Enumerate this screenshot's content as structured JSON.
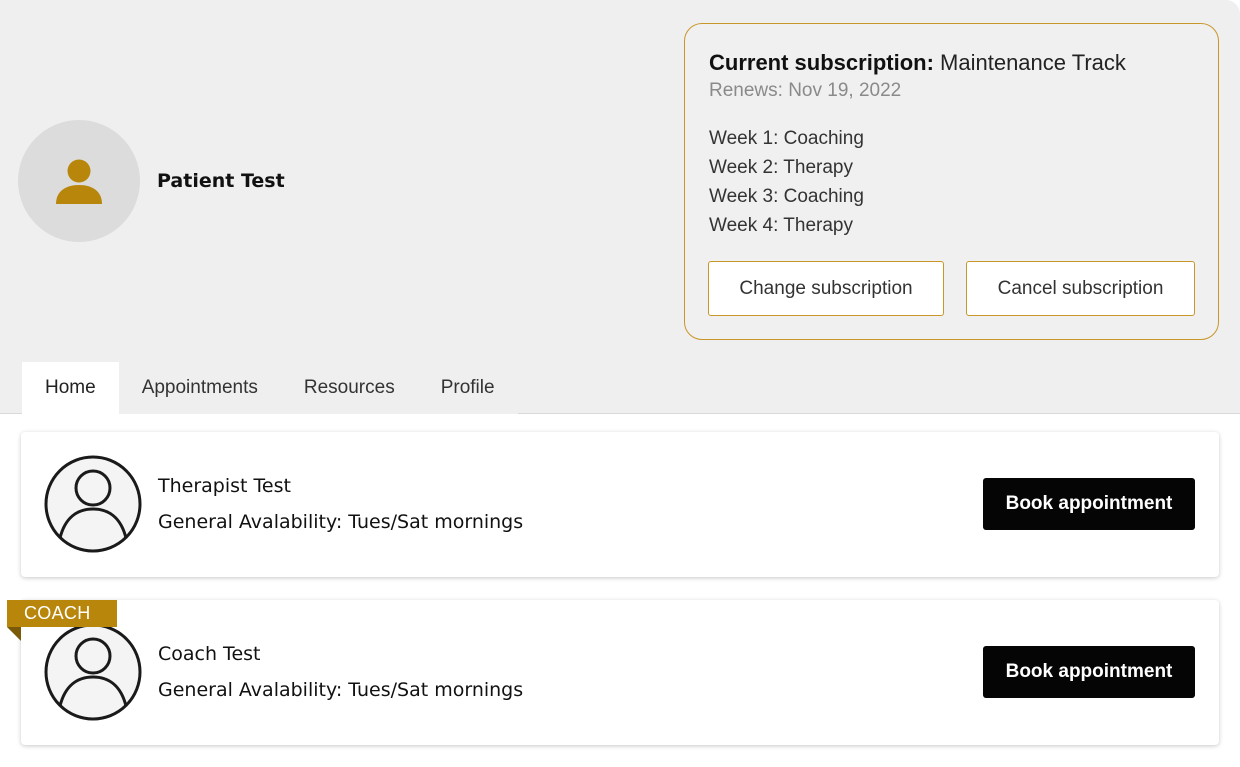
{
  "user": {
    "name": "Patient Test",
    "avatar_icon": "person-icon",
    "accent_color": "#b8860b"
  },
  "subscription": {
    "label": "Current subscription:",
    "plan": "Maintenance Track",
    "renews": "Renews: Nov 19, 2022",
    "weeks": [
      "Week 1: Coaching",
      "Week 2: Therapy",
      "Week 3: Coaching",
      "Week 4: Therapy"
    ],
    "change_label": "Change subscription",
    "cancel_label": "Cancel subscription"
  },
  "tabs": [
    {
      "label": "Home",
      "active": true
    },
    {
      "label": "Appointments",
      "active": false
    },
    {
      "label": "Resources",
      "active": false
    },
    {
      "label": "Profile",
      "active": false
    }
  ],
  "providers": [
    {
      "name": "Therapist Test",
      "availability": "General Avalability: Tues/Sat mornings",
      "book_label": "Book appointment",
      "avatar_icon": "user-outline-icon"
    },
    {
      "badge": "COACH",
      "name": "Coach Test",
      "availability": "General Avalability: Tues/Sat mornings",
      "book_label": "Book appointment",
      "avatar_icon": "user-outline-icon"
    }
  ]
}
